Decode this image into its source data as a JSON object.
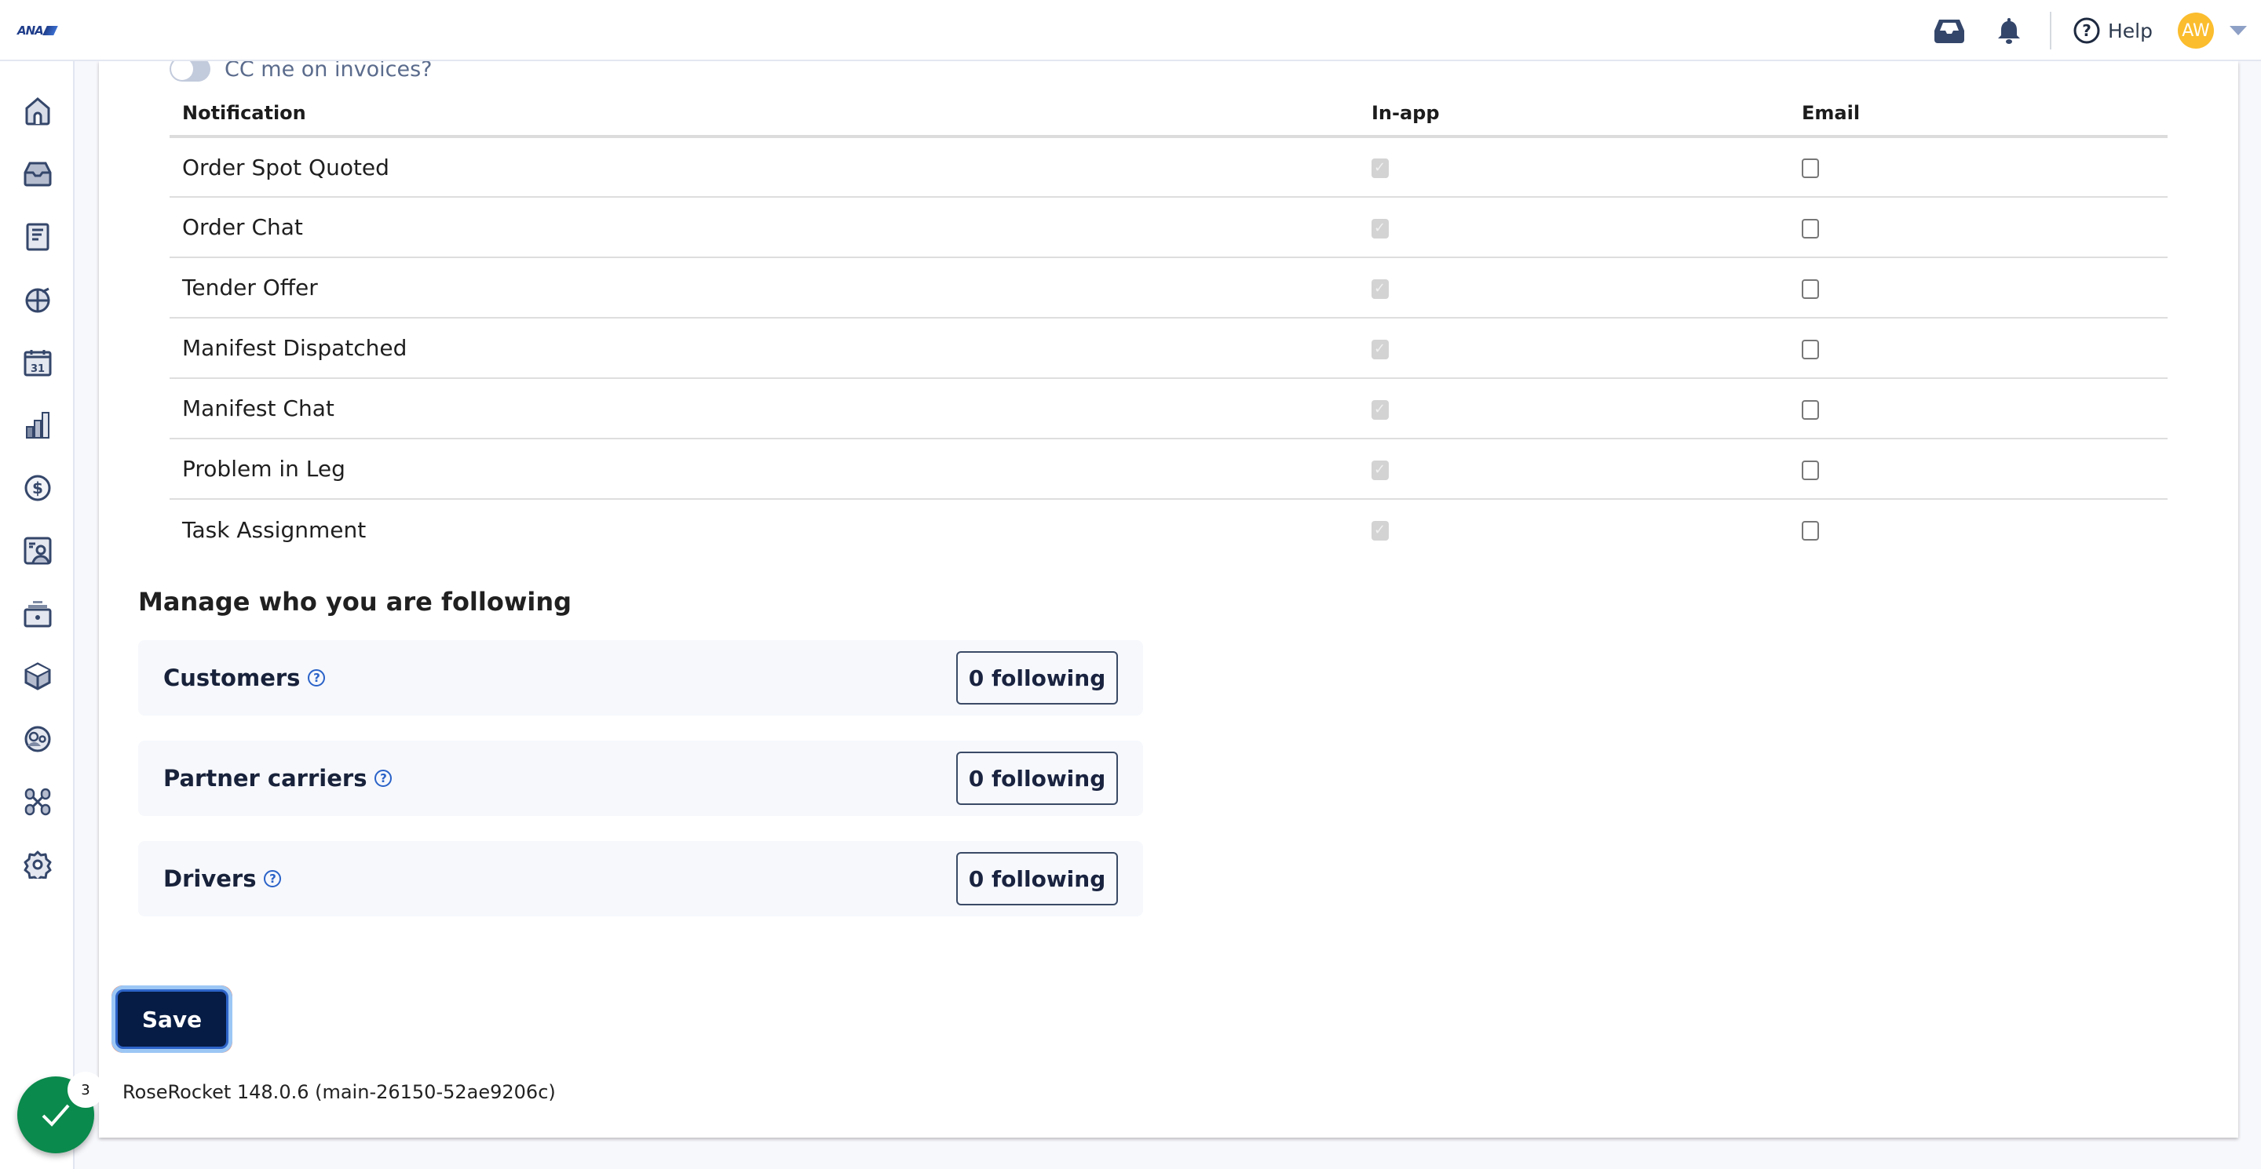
{
  "header": {
    "logo_text": "ANA",
    "help_label": "Help",
    "avatar_initials": "AW",
    "colors": {
      "avatar": "#fbbd2e",
      "icon": "#34466a"
    }
  },
  "sidebar": {
    "items": [
      {
        "name": "home",
        "icon": "home-icon"
      },
      {
        "name": "inbox",
        "icon": "inbox-icon"
      },
      {
        "name": "documents",
        "icon": "document-icon"
      },
      {
        "name": "tracking",
        "icon": "globe-icon"
      },
      {
        "name": "calendar",
        "icon": "calendar-icon",
        "label": "31"
      },
      {
        "name": "reports",
        "icon": "bar-chart-icon"
      },
      {
        "name": "billing",
        "icon": "dollar-icon"
      },
      {
        "name": "contacts",
        "icon": "contact-card-icon"
      },
      {
        "name": "assets",
        "icon": "drawer-icon"
      },
      {
        "name": "inventory",
        "icon": "box-icon"
      },
      {
        "name": "users",
        "icon": "users-icon"
      },
      {
        "name": "integrations",
        "icon": "network-icon"
      },
      {
        "name": "settings",
        "icon": "gear-icon"
      }
    ]
  },
  "cc_invoices": {
    "label": "CC me on invoices?",
    "enabled": false
  },
  "notifications": {
    "columns": [
      "Notification",
      "In-app",
      "Email"
    ],
    "rows": [
      {
        "name": "Order Spot Quoted",
        "in_app": true,
        "email": false
      },
      {
        "name": "Order Chat",
        "in_app": true,
        "email": false
      },
      {
        "name": "Tender Offer",
        "in_app": true,
        "email": false
      },
      {
        "name": "Manifest Dispatched",
        "in_app": true,
        "email": false
      },
      {
        "name": "Manifest Chat",
        "in_app": true,
        "email": false
      },
      {
        "name": "Problem in Leg",
        "in_app": true,
        "email": false
      },
      {
        "name": "Task Assignment",
        "in_app": true,
        "email": false
      }
    ]
  },
  "following": {
    "title": "Manage who you are following",
    "items": [
      {
        "label": "Customers",
        "button": "0 following"
      },
      {
        "label": "Partner carriers",
        "button": "0 following"
      },
      {
        "label": "Drivers",
        "button": "0 following"
      }
    ]
  },
  "save_label": "Save",
  "version": "RoseRocket 148.0.6 (main-26150-52ae9206c)",
  "fab": {
    "badge_count": "3",
    "color": "#0a8a4c"
  }
}
